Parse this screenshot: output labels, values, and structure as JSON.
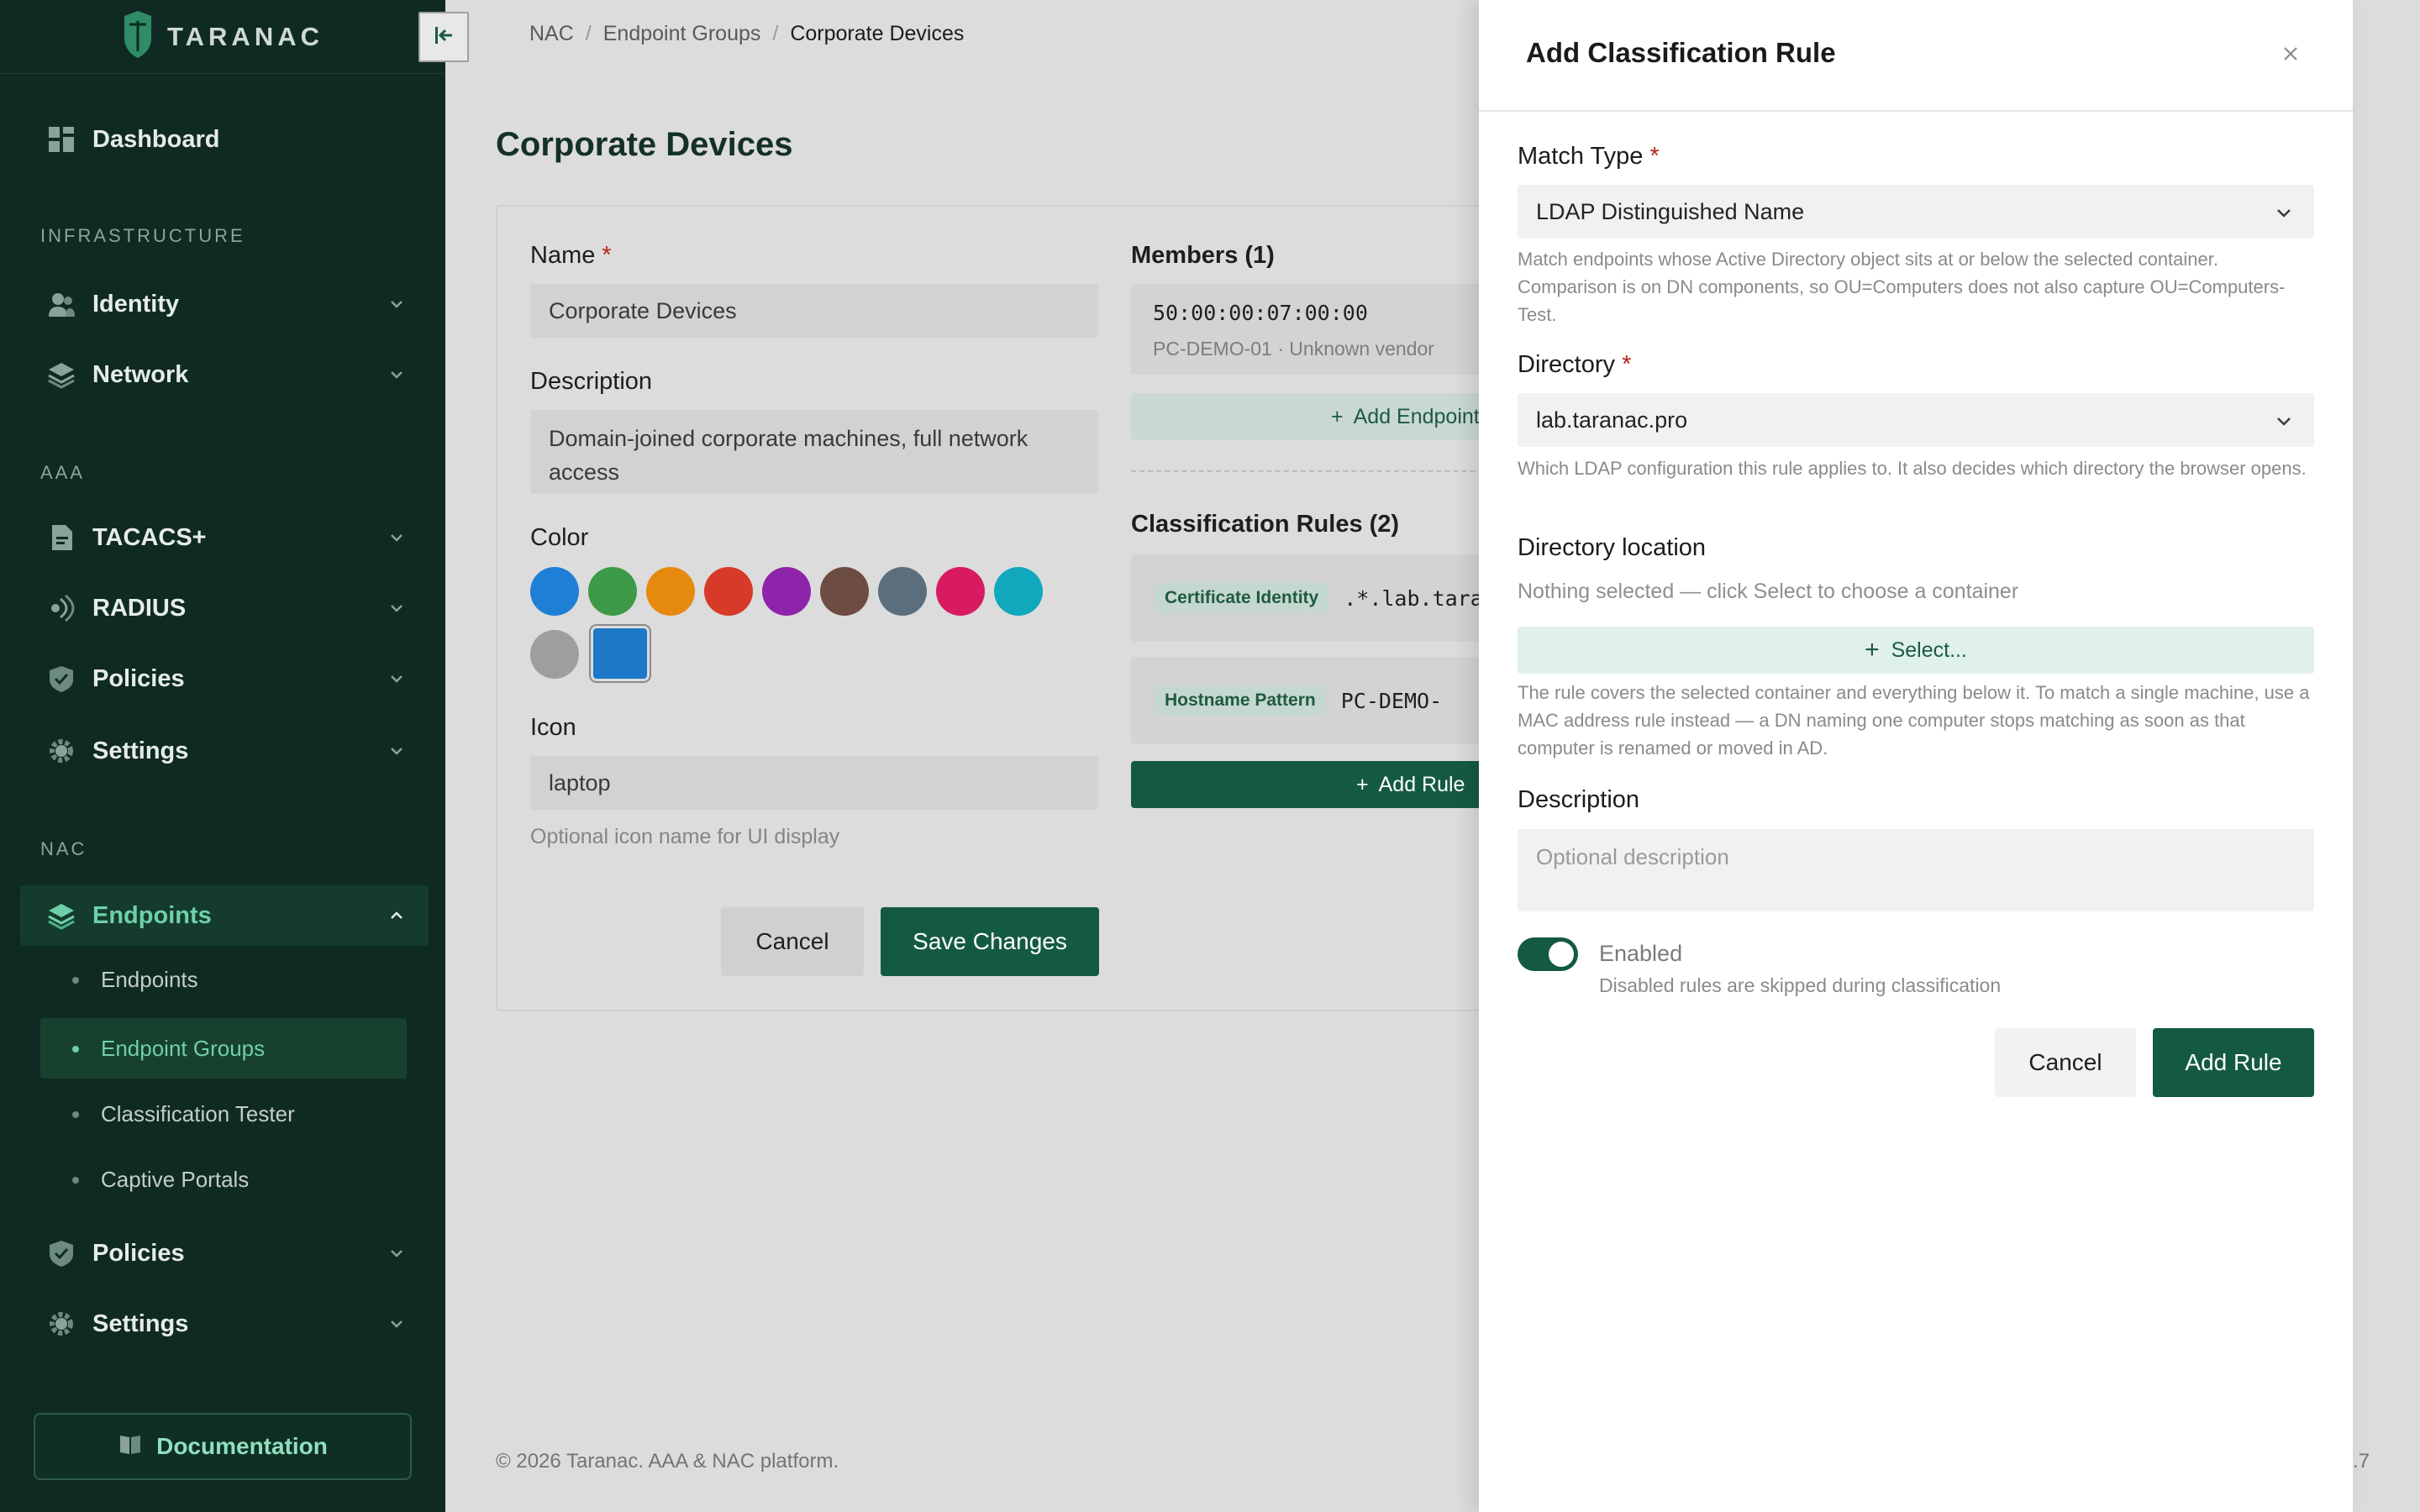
{
  "app": {
    "brand": "TARANAC"
  },
  "sidebar": {
    "dashboard": "Dashboard",
    "sections": {
      "infrastructure": "INFRASTRUCTURE",
      "aaa": "AAA",
      "nac": "NAC"
    },
    "items": {
      "identity": "Identity",
      "network": "Network",
      "tacacs": "TACACS+",
      "radius": "RADIUS",
      "policies_aaa": "Policies",
      "settings_aaa": "Settings",
      "endpoints": "Endpoints",
      "policies_nac": "Policies",
      "settings_nac": "Settings"
    },
    "sub_items": {
      "endpoints": "Endpoints",
      "endpoint_groups": "Endpoint Groups",
      "classification_tester": "Classification Tester",
      "captive_portals": "Captive Portals"
    },
    "documentation": "Documentation"
  },
  "breadcrumb": {
    "root": "NAC",
    "parent": "Endpoint Groups",
    "current": "Corporate Devices",
    "sep": "/"
  },
  "page": {
    "title": "Corporate Devices"
  },
  "form": {
    "name_label": "Name",
    "name_value": "Corporate Devices",
    "description_label": "Description",
    "description_value": "Domain-joined corporate machines, full network access",
    "color_label": "Color",
    "colors": [
      "#1f7fd6",
      "#3d9a48",
      "#e58a0f",
      "#d83a2a",
      "#8e24aa",
      "#6d4c41",
      "#5a6e7d",
      "#d81b60",
      "#11a8bd",
      "#9e9e9e",
      "#1d78c8"
    ],
    "icon_label": "Icon",
    "icon_value": "laptop",
    "icon_hint": "Optional icon name for UI display",
    "cancel": "Cancel",
    "save": "Save Changes",
    "required_mark": "*"
  },
  "members": {
    "title": "Members (1)",
    "mac": "50:00:00:07:00:00",
    "sub": "PC-DEMO-01 · Unknown vendor",
    "add": "Add Endpoint"
  },
  "rules": {
    "title": "Classification Rules (2)",
    "items": [
      {
        "tag": "Certificate Identity",
        "value": ".*.lab.taranac.pro"
      },
      {
        "tag": "Hostname Pattern",
        "value": "PC-DEMO-"
      }
    ],
    "add": "Add Rule"
  },
  "footer": {
    "copyright": "© 2026 Taranac. AAA & NAC platform.",
    "version": ".7"
  },
  "dialog": {
    "title": "Add Classification Rule",
    "match_type_label": "Match Type",
    "match_type_value": "LDAP Distinguished Name",
    "match_type_help": "Match endpoints whose Active Directory object sits at or below the selected container. Comparison is on DN components, so OU=Computers does not also capture OU=Computers-Test.",
    "directory_label": "Directory",
    "directory_value": "lab.taranac.pro",
    "directory_help": "Which LDAP configuration this rule applies to. It also decides which directory the browser opens.",
    "location_label": "Directory location",
    "location_empty": "Nothing selected — click Select to choose a container",
    "select_button": "Select...",
    "location_help": "The rule covers the selected container and everything below it. To match a single machine, use a MAC address rule instead — a DN naming one computer stops matching as soon as that computer is renamed or moved in AD.",
    "description_label": "Description",
    "description_placeholder": "Optional description",
    "enabled_label": "Enabled",
    "enabled_help": "Disabled rules are skipped during classification",
    "enabled": true,
    "cancel": "Cancel",
    "add": "Add Rule"
  }
}
